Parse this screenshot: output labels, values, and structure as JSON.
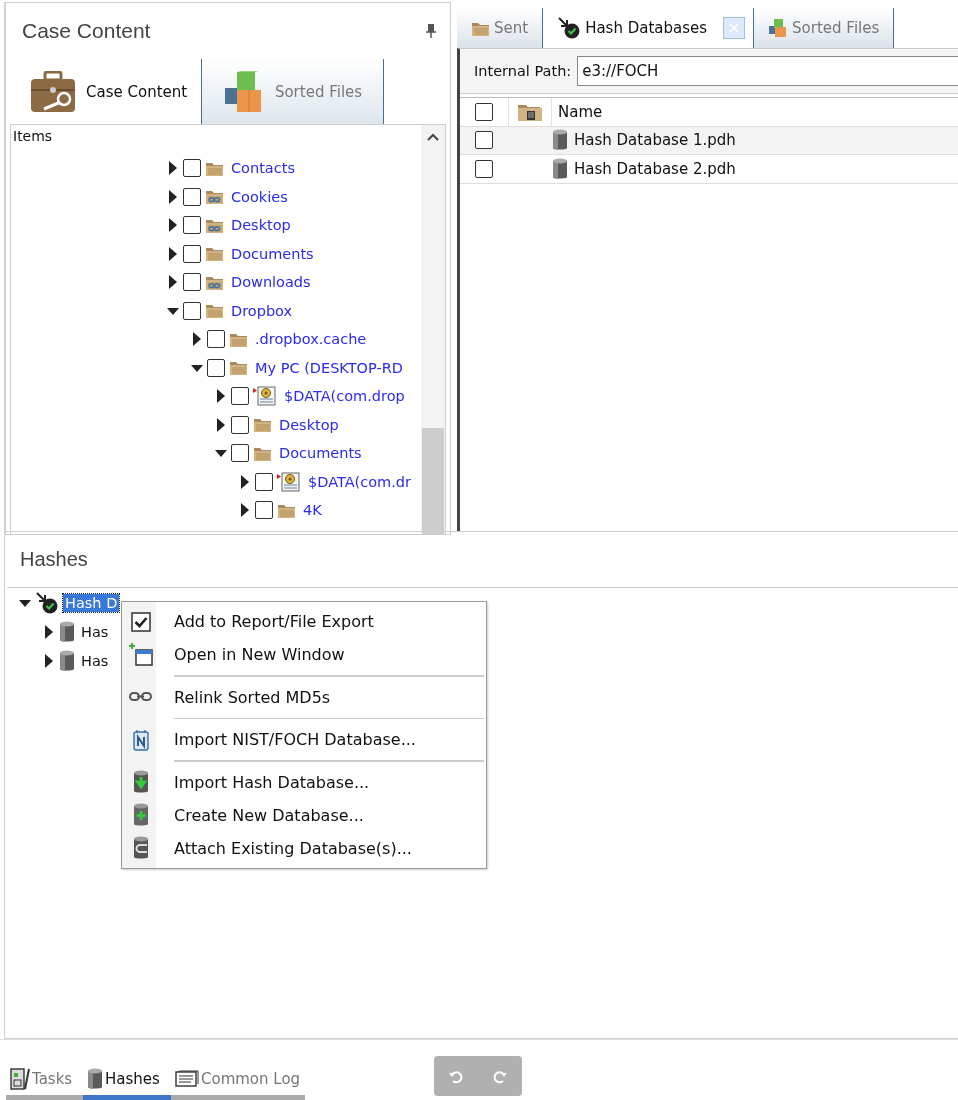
{
  "case_panel": {
    "title": "Case Content",
    "tabs": [
      {
        "label": "Case Content",
        "kind": "case",
        "selected": true
      },
      {
        "label": "Sorted Files",
        "kind": "sorted",
        "selected": false
      }
    ],
    "tree_header": "Items",
    "tree": [
      {
        "label": "Contacts",
        "kind": "folder",
        "expanded": false,
        "checked": false
      },
      {
        "label": "Cookies",
        "kind": "linked-folder",
        "expanded": false,
        "checked": false
      },
      {
        "label": "Desktop",
        "kind": "linked-folder",
        "expanded": false,
        "checked": false
      },
      {
        "label": "Documents",
        "kind": "folder",
        "expanded": false,
        "checked": false
      },
      {
        "label": "Downloads",
        "kind": "linked-folder",
        "expanded": false,
        "checked": false
      },
      {
        "label": "Dropbox",
        "kind": "folder",
        "expanded": true,
        "checked": false,
        "children": [
          {
            "label": ".dropbox.cache",
            "kind": "folder",
            "expanded": false,
            "checked": false
          },
          {
            "label": "My PC (DESKTOP-RD",
            "kind": "folder",
            "expanded": true,
            "checked": false,
            "children": [
              {
                "label": "$DATA(com.drop",
                "kind": "file",
                "expanded": false,
                "checked": false
              },
              {
                "label": "Desktop",
                "kind": "folder",
                "expanded": false,
                "checked": false
              },
              {
                "label": "Documents",
                "kind": "folder",
                "expanded": true,
                "checked": false,
                "children": [
                  {
                    "label": "$DATA(com.dr",
                    "kind": "file",
                    "expanded": false,
                    "checked": false
                  },
                  {
                    "label": "4K",
                    "kind": "folder",
                    "expanded": false,
                    "checked": false
                  }
                ]
              }
            ]
          }
        ]
      }
    ]
  },
  "doc_panel": {
    "tabs": [
      {
        "label": "Sent",
        "kind": "folder",
        "selected": false,
        "closable": false
      },
      {
        "label": "Hash Databases",
        "kind": "hashdb",
        "selected": true,
        "closable": true
      },
      {
        "label": "Sorted Files",
        "kind": "sorted",
        "selected": false,
        "closable": false
      }
    ],
    "path": {
      "label": "Internal Path:",
      "value": "e3://FOCH"
    },
    "table": {
      "columns": [
        "Name"
      ],
      "header_checked": false,
      "rows": [
        {
          "name": "Hash Database 1.pdh",
          "checked": false
        },
        {
          "name": "Hash Database 2.pdh",
          "checked": false
        }
      ]
    }
  },
  "hashes_panel": {
    "title": "Hashes",
    "tree": [
      {
        "label": "Hash D",
        "kind": "hashdb",
        "expanded": true,
        "selected": true,
        "children": [
          {
            "label": "Has",
            "kind": "db",
            "expanded": false,
            "selected": false
          },
          {
            "label": "Has",
            "kind": "db",
            "expanded": false,
            "selected": false
          }
        ]
      }
    ]
  },
  "context_menu": {
    "groups": [
      [
        {
          "label": "Add to Report/File Export",
          "kind": "check"
        },
        {
          "label": "Open in New Window",
          "kind": "window"
        }
      ],
      [
        {
          "label": "Relink Sorted MD5s",
          "kind": "link"
        }
      ],
      [
        {
          "label": "Import NIST/FOCH Database...",
          "kind": "nist"
        }
      ],
      [
        {
          "label": "Import Hash Database...",
          "kind": "import"
        },
        {
          "label": "Create New Database...",
          "kind": "create"
        },
        {
          "label": "Attach Existing Database(s)...",
          "kind": "attach"
        }
      ]
    ]
  },
  "bottom_tabs": [
    {
      "label": "Tasks",
      "kind": "tasks",
      "selected": false
    },
    {
      "label": "Hashes",
      "kind": "db",
      "selected": true
    },
    {
      "label": "Common Log",
      "kind": "log",
      "selected": false
    }
  ]
}
